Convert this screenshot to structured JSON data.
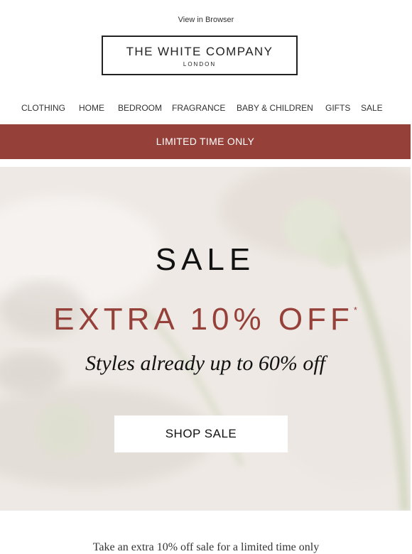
{
  "header": {
    "view_in_browser": "View in Browser",
    "brand_name": "THE WHITE COMPANY",
    "brand_sub": "LONDON"
  },
  "nav": {
    "items": [
      {
        "label": "CLOTHING"
      },
      {
        "label": "HOME"
      },
      {
        "label": "BEDROOM"
      },
      {
        "label": "FRAGRANCE"
      },
      {
        "label": "BABY & CHILDREN"
      },
      {
        "label": "GIFTS"
      },
      {
        "label": "SALE"
      }
    ]
  },
  "banner": {
    "text": "LIMITED TIME ONLY",
    "color": "#95413a"
  },
  "hero": {
    "title": "SALE",
    "offer": "EXTRA 10% OFF",
    "offer_asterisk": "*",
    "subtitle": "Styles already up to 60% off",
    "button_label": "SHOP SALE",
    "accent_color": "#95413a"
  },
  "footer": {
    "text": "Take an extra 10% off sale for a limited time only"
  }
}
